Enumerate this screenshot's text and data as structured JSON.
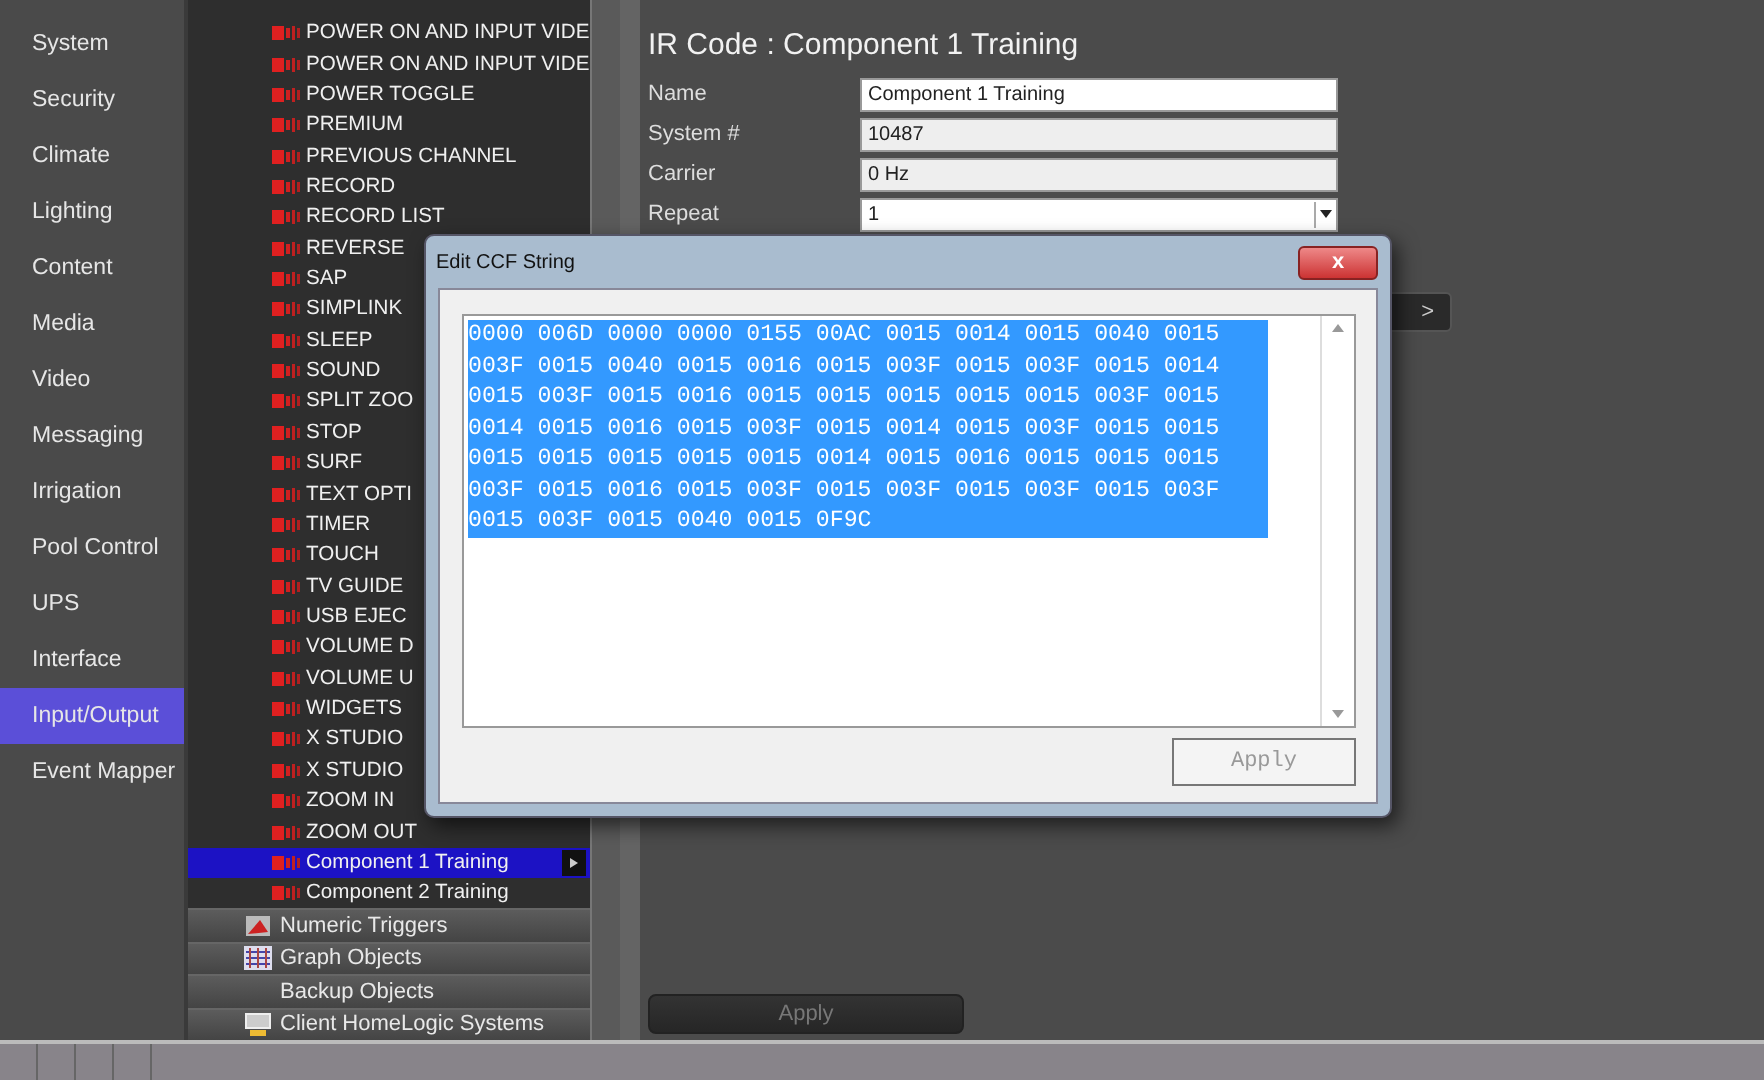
{
  "nav": [
    {
      "label": "System",
      "selected": false
    },
    {
      "label": "Security",
      "selected": false
    },
    {
      "label": "Climate",
      "selected": false
    },
    {
      "label": "Lighting",
      "selected": false
    },
    {
      "label": "Content",
      "selected": false
    },
    {
      "label": "Media",
      "selected": false
    },
    {
      "label": "Video",
      "selected": false
    },
    {
      "label": "Messaging",
      "selected": false
    },
    {
      "label": "Irrigation",
      "selected": false
    },
    {
      "label": "Pool Control",
      "selected": false
    },
    {
      "label": "UPS",
      "selected": false
    },
    {
      "label": "Interface",
      "selected": false
    },
    {
      "label": "Input/Output",
      "selected": true
    },
    {
      "label": "Event Mapper",
      "selected": false
    }
  ],
  "tree": [
    {
      "kind": "ir",
      "label": "POWER ON AND INPUT VIDE",
      "selected": false
    },
    {
      "kind": "ir",
      "label": "POWER ON AND INPUT VIDE",
      "selected": false
    },
    {
      "kind": "ir",
      "label": "POWER TOGGLE",
      "selected": false
    },
    {
      "kind": "ir",
      "label": "PREMIUM",
      "selected": false
    },
    {
      "kind": "ir",
      "label": "PREVIOUS CHANNEL",
      "selected": false
    },
    {
      "kind": "ir",
      "label": "RECORD",
      "selected": false
    },
    {
      "kind": "ir",
      "label": "RECORD LIST",
      "selected": false
    },
    {
      "kind": "ir",
      "label": "REVERSE",
      "selected": false
    },
    {
      "kind": "ir",
      "label": "SAP",
      "selected": false
    },
    {
      "kind": "ir",
      "label": "SIMPLINK",
      "selected": false
    },
    {
      "kind": "ir",
      "label": "SLEEP",
      "selected": false
    },
    {
      "kind": "ir",
      "label": "SOUND",
      "selected": false
    },
    {
      "kind": "ir",
      "label": "SPLIT ZOO",
      "selected": false
    },
    {
      "kind": "ir",
      "label": "STOP",
      "selected": false
    },
    {
      "kind": "ir",
      "label": "SURF",
      "selected": false
    },
    {
      "kind": "ir",
      "label": "TEXT OPTI",
      "selected": false
    },
    {
      "kind": "ir",
      "label": "TIMER",
      "selected": false
    },
    {
      "kind": "ir",
      "label": "TOUCH",
      "selected": false
    },
    {
      "kind": "ir",
      "label": "TV GUIDE",
      "selected": false
    },
    {
      "kind": "ir",
      "label": "USB EJEC",
      "selected": false
    },
    {
      "kind": "ir",
      "label": "VOLUME D",
      "selected": false
    },
    {
      "kind": "ir",
      "label": "VOLUME U",
      "selected": false
    },
    {
      "kind": "ir",
      "label": "WIDGETS",
      "selected": false
    },
    {
      "kind": "ir",
      "label": "X STUDIO",
      "selected": false
    },
    {
      "kind": "ir",
      "label": "X STUDIO",
      "selected": false
    },
    {
      "kind": "ir",
      "label": "ZOOM IN",
      "selected": false
    },
    {
      "kind": "ir",
      "label": "ZOOM OUT",
      "selected": false
    },
    {
      "kind": "ir",
      "label": "Component 1 Training",
      "selected": true
    },
    {
      "kind": "ir",
      "label": "Component 2 Training",
      "selected": false
    },
    {
      "kind": "triggers",
      "label": "Numeric Triggers"
    },
    {
      "kind": "graphs",
      "label": "Graph Objects"
    },
    {
      "kind": "backups",
      "label": "Backup Objects"
    },
    {
      "kind": "clients",
      "label": "Client HomeLogic Systems"
    }
  ],
  "detail": {
    "title": "IR Code : Component 1 Training",
    "fields": [
      {
        "label": "Name",
        "value": "Component 1 Training",
        "kind": "text",
        "editable": true
      },
      {
        "label": "System #",
        "value": "10487",
        "kind": "text",
        "editable": false
      },
      {
        "label": "Carrier",
        "value": "0 Hz",
        "kind": "text",
        "editable": false
      },
      {
        "label": "Repeat",
        "value": "1",
        "kind": "select",
        "editable": true
      }
    ],
    "next_button": ">",
    "apply_button": "Apply"
  },
  "dialog": {
    "title": "Edit CCF String",
    "close": "x",
    "text": "0000 006D 0000 0000 0155 00AC 0015 0014 0015 0040 0015 003F 0015 0040 0015 0016 0015 003F 0015 003F 0015 0014 0015 003F 0015 0016 0015 0015 0015 0015 0015 003F 0015 0014 0015 0016 0015 003F 0015 0014 0015 003F 0015 0015 0015 0015 0015 0015 0015 0014 0015 0016 0015 0015 0015 003F 0015 0016 0015 003F 0015 003F 0015 003F 0015 003F 0015 003F 0015 0040 0015 0F9C",
    "text_selected": true,
    "apply_button": "Apply"
  }
}
